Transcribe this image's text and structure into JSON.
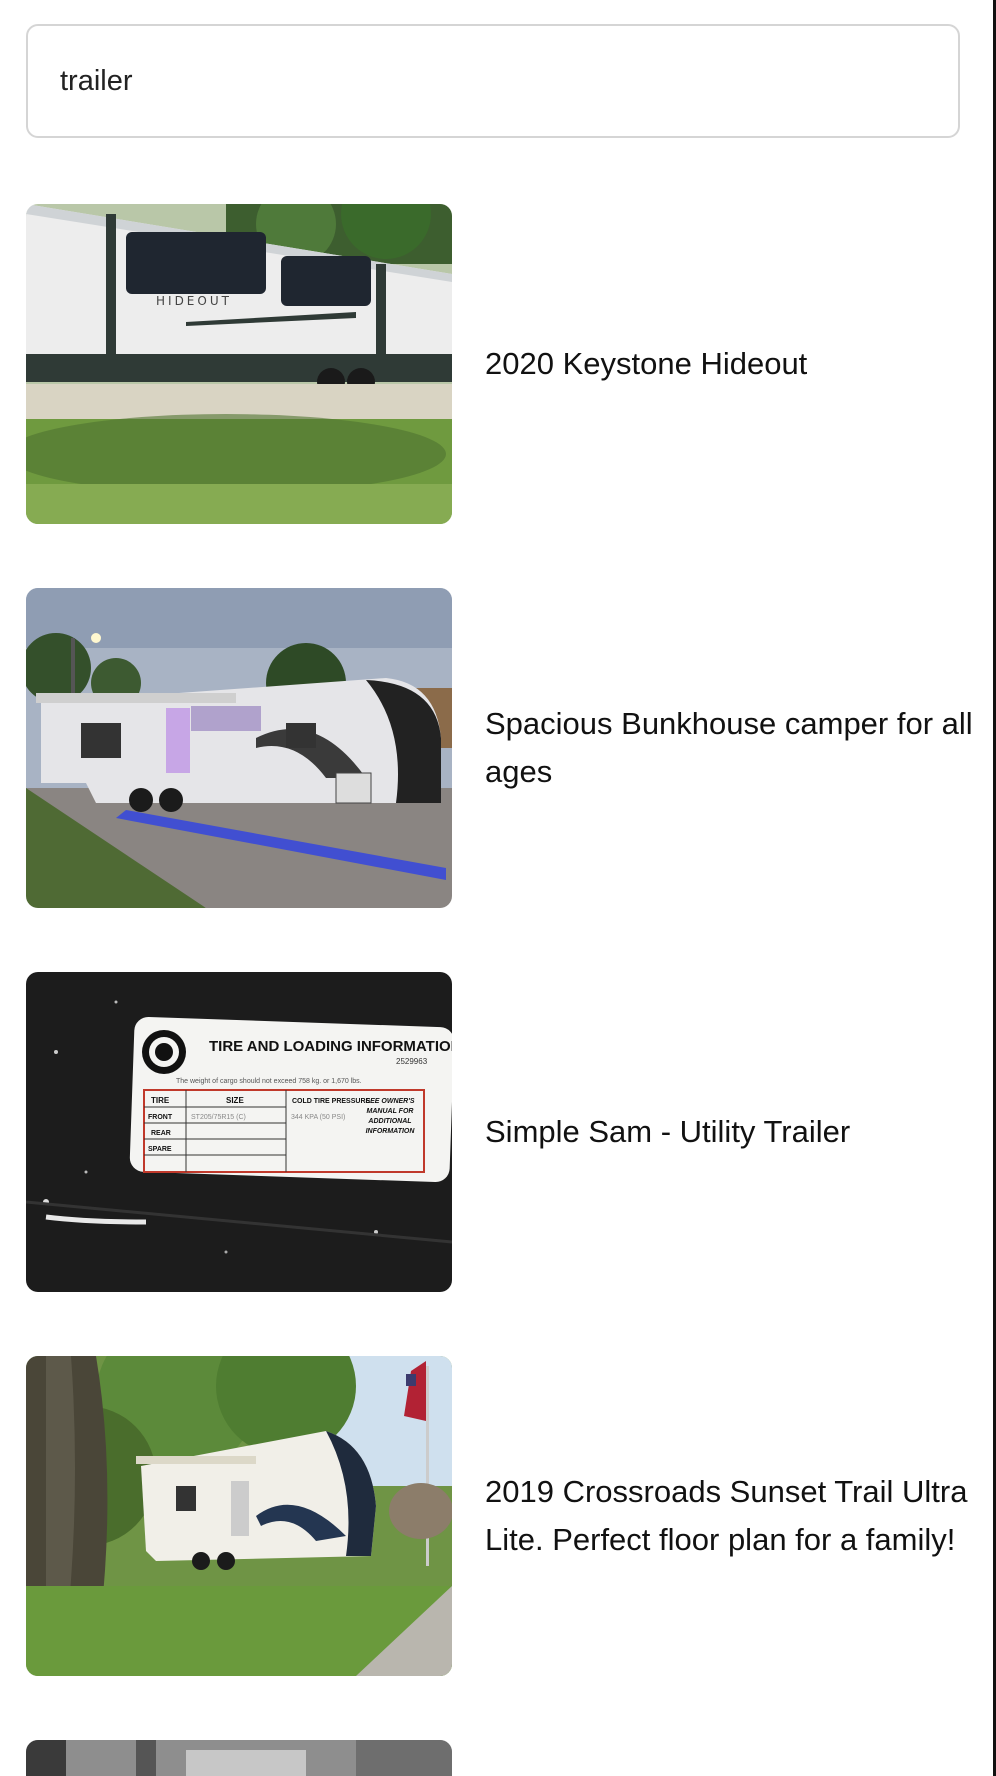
{
  "search": {
    "value": "trailer"
  },
  "results": [
    {
      "title": "2020 Keystone Hideout",
      "image_icon": "trailer-photo-hideout"
    },
    {
      "title": "Spacious Bunkhouse camper for all ages",
      "image_icon": "trailer-photo-bunkhouse"
    },
    {
      "title": "Simple Sam - Utility Trailer",
      "image_icon": "tire-loading-label-photo"
    },
    {
      "title": "2019 Crossroads Sunset Trail Ultra Lite. Perfect floor plan for a family!",
      "image_icon": "trailer-photo-sunset-trail"
    }
  ],
  "tire_label": {
    "heading": "TIRE AND LOADING INFORMATION",
    "code": "2529963",
    "cargo_note": "The weight of cargo should not exceed 758 kg. or 1,670 lbs.",
    "col_tire": "TIRE",
    "col_size": "SIZE",
    "col_pressure": "COLD TIRE PRESSURE",
    "row_front": "FRONT",
    "row_rear": "REAR",
    "row_spare": "SPARE",
    "size_value": "ST205/75R15 (C)",
    "pressure_value": "344 KPA (50 PSI)",
    "see_manual": "SEE OWNER'S MANUAL FOR ADDITIONAL INFORMATION"
  },
  "trailer_brand": "HIDEOUT",
  "colors": {
    "border": "#d5d5d5",
    "text": "#111111"
  }
}
